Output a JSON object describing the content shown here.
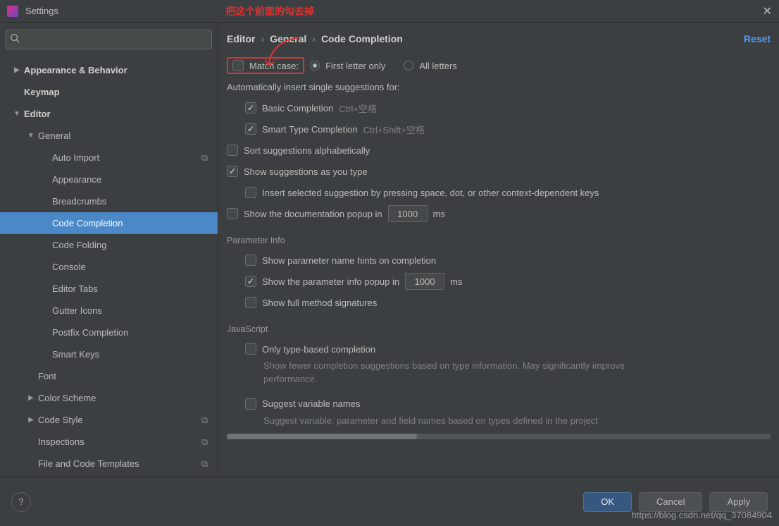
{
  "window": {
    "title": "Settings"
  },
  "annotation": "把这个前面的勾去掉",
  "sidebar": {
    "items": [
      {
        "label": "Appearance & Behavior",
        "bold": true,
        "expander": "▶",
        "indent": 0
      },
      {
        "label": "Keymap",
        "bold": true,
        "expander": "",
        "indent": 0
      },
      {
        "label": "Editor",
        "bold": true,
        "expander": "▼",
        "indent": 0
      },
      {
        "label": "General",
        "bold": false,
        "expander": "▼",
        "indent": 1
      },
      {
        "label": "Auto Import",
        "bold": false,
        "expander": "",
        "indent": 2,
        "copy": true
      },
      {
        "label": "Appearance",
        "bold": false,
        "expander": "",
        "indent": 2
      },
      {
        "label": "Breadcrumbs",
        "bold": false,
        "expander": "",
        "indent": 2
      },
      {
        "label": "Code Completion",
        "bold": false,
        "expander": "",
        "indent": 2,
        "selected": true
      },
      {
        "label": "Code Folding",
        "bold": false,
        "expander": "",
        "indent": 2
      },
      {
        "label": "Console",
        "bold": false,
        "expander": "",
        "indent": 2
      },
      {
        "label": "Editor Tabs",
        "bold": false,
        "expander": "",
        "indent": 2
      },
      {
        "label": "Gutter Icons",
        "bold": false,
        "expander": "",
        "indent": 2
      },
      {
        "label": "Postfix Completion",
        "bold": false,
        "expander": "",
        "indent": 2
      },
      {
        "label": "Smart Keys",
        "bold": false,
        "expander": "",
        "indent": 2
      },
      {
        "label": "Font",
        "bold": false,
        "expander": "",
        "indent": 1
      },
      {
        "label": "Color Scheme",
        "bold": false,
        "expander": "▶",
        "indent": 1
      },
      {
        "label": "Code Style",
        "bold": false,
        "expander": "▶",
        "indent": 1,
        "copy": true
      },
      {
        "label": "Inspections",
        "bold": false,
        "expander": "",
        "indent": 1,
        "copy": true
      },
      {
        "label": "File and Code Templates",
        "bold": false,
        "expander": "",
        "indent": 1,
        "copy": true
      }
    ]
  },
  "breadcrumb": {
    "a": "Editor",
    "b": "General",
    "c": "Code Completion",
    "reset": "Reset"
  },
  "options": {
    "match_case": "Match case:",
    "first_letter": "First letter only",
    "all_letters": "All letters",
    "auto_insert": "Automatically insert single suggestions for:",
    "basic": "Basic Completion",
    "basic_hint": "Ctrl+空格",
    "smart": "Smart Type Completion",
    "smart_hint": "Ctrl+Shift+空格",
    "sort": "Sort suggestions alphabetically",
    "asyoutype": "Show suggestions as you type",
    "insert_selected": "Insert selected suggestion by pressing space, dot, or other context-dependent keys",
    "docpopup_a": "Show the documentation popup in",
    "docpopup_val": "1000",
    "docpopup_b": "ms",
    "param_section": "Parameter Info",
    "param_hints": "Show parameter name hints on completion",
    "param_popup_a": "Show the parameter info popup in",
    "param_popup_val": "1000",
    "param_popup_b": "ms",
    "full_sig": "Show full method signatures",
    "js_section": "JavaScript",
    "typebased": "Only type-based completion",
    "typebased_desc": "Show fewer completion suggestions based on type information. May significantly improve performance.",
    "suggest_var": "Suggest variable names",
    "suggest_var_desc": "Suggest variable, parameter and field names based on types defined in the project"
  },
  "footer": {
    "ok": "OK",
    "cancel": "Cancel",
    "apply": "Apply"
  },
  "watermark": "https://blog.csdn.net/qq_37084904"
}
